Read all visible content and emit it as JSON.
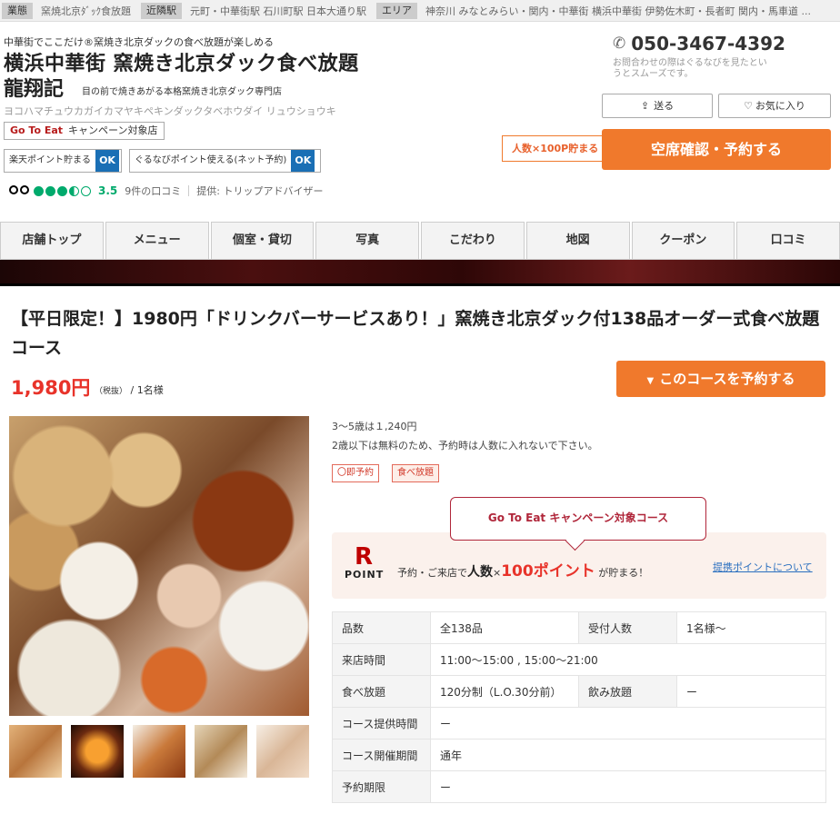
{
  "topbar": {
    "genre_label": "業態",
    "genre_value": "窯焼北京ﾀﾞｯｸ食放題",
    "station_label": "近隣駅",
    "station_value": "元町・中華街駅 石川町駅 日本大通り駅",
    "area_label": "エリア",
    "area_value": "神奈川 みなとみらい・関内・中華街 横浜中華街 伊勢佐木町・長者町 関内・馬車道 ..."
  },
  "header": {
    "catch": "中華街でここだけ®窯焼き北京ダックの食べ放題が楽しめる",
    "name_line1": "横浜中華街 窯焼き北京ダック食べ放題",
    "name_line2": "龍翔記",
    "subcatch": "目の前で焼きあがる本格窯焼き北京ダック専門店",
    "kana": "ヨコハマチュウカガイカマヤキペキンダックタベホウダイ リュウショウキ",
    "gte_badge_bold": "Go To Eat",
    "gte_badge_text": "キャンペーン対象店",
    "point1_label": "楽天ポイント貯まる",
    "point1_ok": "OK",
    "point2_label": "ぐるなびポイント使える(ネット予約)",
    "point2_ok": "OK",
    "rating_score": "3.5",
    "rating_count": "9件の口コミ",
    "rating_provider": "提供: トリップアドバイザー",
    "rating_fraction": 0.7,
    "phone_number": "050-3467-4392",
    "phone_note": "お問合わせの際はぐるなびを見たというとスムーズです。",
    "send_label": "送る",
    "favorite_label": "お気に入り",
    "point_tag": "人数×100P貯まる",
    "point_tag_q": "?",
    "reserve_label": "空席確認・予約する"
  },
  "nav": [
    "店舗トップ",
    "メニュー",
    "個室・貸切",
    "写真",
    "こだわり",
    "地図",
    "クーポン",
    "口コミ"
  ],
  "course": {
    "title": "【平日限定！】1980円「ドリンクバーサービスあり！」窯焼き北京ダック付138品オーダー式食べ放題コース",
    "price": "1,980円",
    "price_tax": "（税抜）",
    "price_per": "/ 1名様",
    "reserve_label": "このコースを予約する",
    "reserve_arrow": "▼",
    "info1": "3～5歳は１,240円",
    "info2": "2歳以下は無料のため、予約時は人数に入れないで下さい。",
    "tag1": "〇即予約",
    "tag2": "食べ放題",
    "gte_callout": "Go To Eat キャンペーン対象コース",
    "rpoint_logo": "R",
    "rpoint_logo_text": "POINT",
    "rpoint_pre": "予約・ご来店で",
    "rpoint_bold": "人数",
    "rpoint_x": "×",
    "rpoint_points": "100ポイント",
    "rpoint_post": "が貯まる！",
    "rpoint_link": "提携ポイントについて",
    "table": [
      {
        "h1": "品数",
        "v1": "全138品",
        "h2": "受付人数",
        "v2": "1名様～"
      },
      {
        "h1": "来店時間",
        "v1": "11:00～15:00 , 15:00～21:00"
      },
      {
        "h1": "食べ放題",
        "v1": "120分制（L.O.30分前）",
        "h2": "飲み放題",
        "v2": "ー"
      },
      {
        "h1": "コース提供時間",
        "v1": "ー"
      },
      {
        "h1": "コース開催期間",
        "v1": "通年"
      },
      {
        "h1": "予約期限",
        "v1": "ー"
      }
    ]
  }
}
